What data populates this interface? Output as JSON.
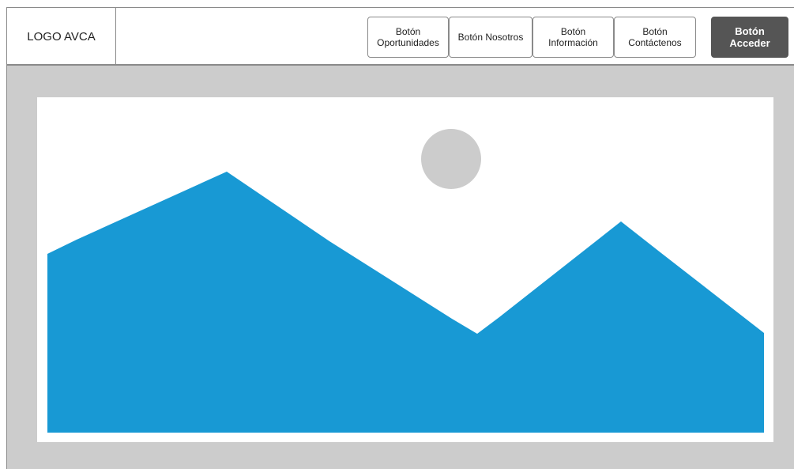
{
  "header": {
    "logo_text": "LOGO AVCA",
    "nav": {
      "opportunities": {
        "line1": "Botón",
        "line2": "Oportunidades"
      },
      "about": {
        "line1": "Botón Nosotros"
      },
      "information": {
        "line1": "Botón",
        "line2": "Información"
      },
      "contact": {
        "line1": "Botón",
        "line2": "Contáctenos"
      },
      "access": {
        "line1": "Botón",
        "line2": "Acceder"
      }
    }
  },
  "hero": {
    "image_icon": "image-placeholder-icon",
    "colors": {
      "sky": "#ffffff",
      "mountains": "#1899d4",
      "sun": "#cccccc",
      "background": "#cccccc"
    }
  }
}
